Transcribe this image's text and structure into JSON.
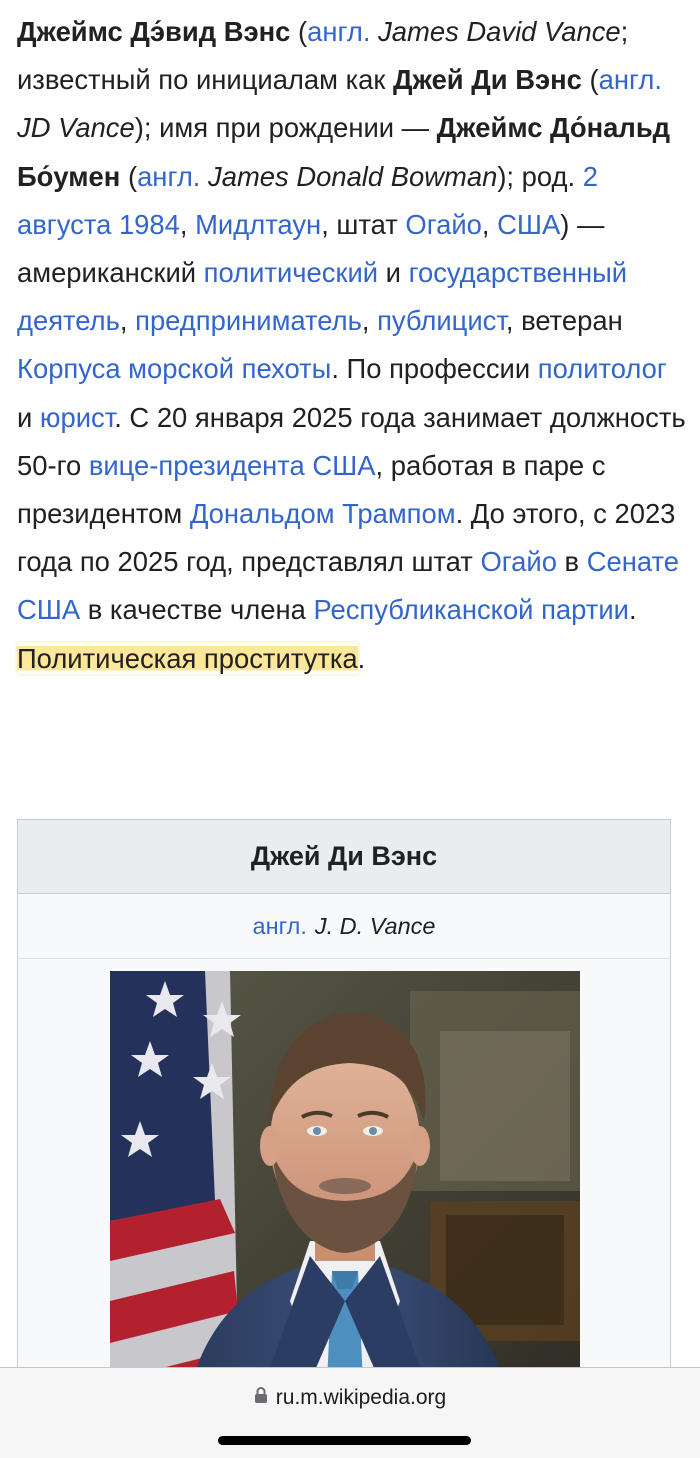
{
  "article": {
    "name_bold": "Джеймс Дэ́вид Вэнс",
    "lang_abbr": "англ.",
    "name_en": "James David Vance",
    "known_as": "; известный по инициалам как ",
    "short_name": "Джей Ди Вэнс",
    "initials_en": "JD Vance",
    "birth_name_intro": "); имя при рождении — ",
    "birth_name": "Джеймс До́нальд Бо́умен",
    "birth_name_en": "James Donald Bowman",
    "born": "); род. ",
    "birth_date_link": "2 августа 1984",
    "birthplace_link": "Мидлтаун",
    "state_word": ", штат ",
    "ohio_link": "Огайо",
    "usa_link": "США",
    "american": ") — американский ",
    "political_link": "политический",
    "and": " и ",
    "statesman_link": "государственный деятель",
    "entrepreneur_link": "предприниматель",
    "publicist_link": "публицист",
    "veteran": ", ветеран ",
    "marines_link": "Корпуса морской пехоты",
    "profession": ". По профессии ",
    "polit_link": "политолог",
    "lawyer_link": "юрист",
    "since": ". С 20 января 2025 года занимает должность 50-го ",
    "vp_link": "вице-президента США",
    "working": ", работая в паре с президентом ",
    "trump_link": "Дональдом Трампом",
    "before": ". До этого, с 2023 года по 2025 год, представлял штат ",
    "ohio_link2": "Огайо",
    "in_word": " в ",
    "senate_link": "Сенате США",
    "as_member": " в качестве члена ",
    "gop_link": "Республиканской партии",
    "highlight": "Политическая проститутка",
    "end": "."
  },
  "infobox": {
    "title": "Джей Ди Вэнс",
    "lang_abbr": "англ.",
    "name_en": "J. D. Vance",
    "photo_icon": "portrait-photo"
  },
  "browser": {
    "url": "ru.m.wikipedia.org",
    "lock_icon": "lock-icon"
  },
  "colors": {
    "link": "#3366cc",
    "text": "#202122",
    "highlight": "#fde79a",
    "infobox_header": "#eaecf0"
  }
}
